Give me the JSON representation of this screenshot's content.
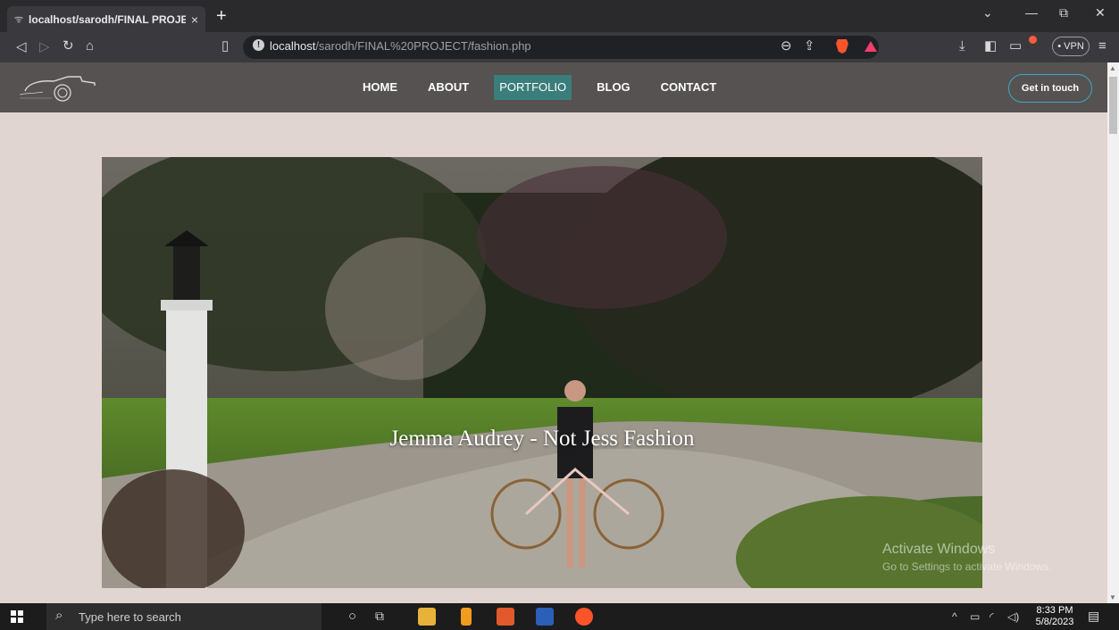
{
  "browser": {
    "tab_title": "localhost/sarodh/FINAL PROJECT",
    "tab_close": "×",
    "new_tab": "+",
    "url_host": "localhost",
    "url_path": "/sarodh/FINAL%20PROJECT/fashion.php",
    "vpn_label": "• VPN",
    "window_controls": [
      "⌄",
      "—",
      "⧉",
      "✕"
    ]
  },
  "site": {
    "nav": [
      "HOME",
      "ABOUT",
      "PORTFOLIO",
      "BLOG",
      "CONTACT"
    ],
    "active_nav": "PORTFOLIO",
    "cta_label": "Get in touch",
    "accent": "#3a7d7a",
    "nav_bg": "#555251",
    "page_bg": "#e0d5d1"
  },
  "hero": {
    "caption": "Jemma Audrey - Not Jess Fashion"
  },
  "watermark": {
    "title": "Activate Windows",
    "subtitle": "Go to Settings to activate Windows."
  },
  "taskbar": {
    "search_placeholder": "Type here to search",
    "time": "8:33 PM",
    "date": "5/8/2023"
  }
}
